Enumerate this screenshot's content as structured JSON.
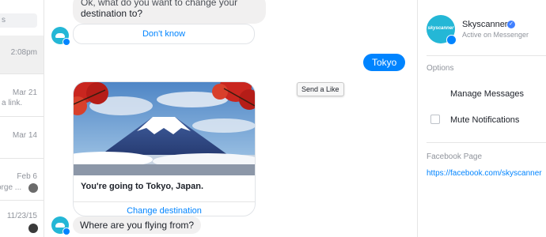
{
  "sidebar": {
    "search_placeholder": "s",
    "conversations": [
      {
        "time": "2:08pm",
        "snippet": "",
        "active": true
      },
      {
        "time": "Mar 21",
        "snippet": "a link.",
        "active": false
      },
      {
        "time": "Mar 14",
        "snippet": "",
        "active": false
      },
      {
        "time": "Feb 6",
        "snippet": "orge ...",
        "active": false
      },
      {
        "time": "11/23/15",
        "snippet": "",
        "active": false
      }
    ]
  },
  "chat": {
    "top_bubble_line1": "Ok, what do you want to change your",
    "top_bubble_line2": "destination to?",
    "dont_know_label": "Don't know",
    "user_reply": "Tokyo",
    "tooltip": "Send a Like",
    "card_title": "You're going to Tokyo, Japan.",
    "card_button": "Change destination",
    "question": "Where are you flying from?"
  },
  "profile": {
    "name": "Skyscanner",
    "status": "Active on Messenger",
    "logo_text": "skyscanner",
    "options_header": "Options",
    "manage_messages": "Manage Messages",
    "mute_notifications": "Mute Notifications",
    "facebook_page_header": "Facebook Page",
    "facebook_link": "https://facebook.com/skyscanner"
  },
  "colors": {
    "messenger_blue": "#0084ff",
    "skyscanner_teal": "#24b7d6",
    "bubble_gray": "#f1f0f0"
  }
}
